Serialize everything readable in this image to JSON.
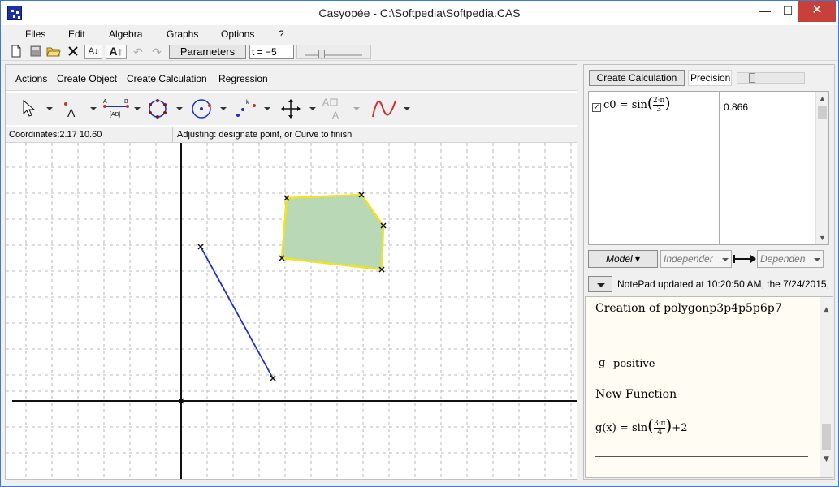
{
  "window": {
    "title": "Casyopée - C:\\Softpedia\\Softpedia.CAS",
    "minimize": "—",
    "maximize": "☐",
    "close": "✕"
  },
  "menu": [
    "Files",
    "Edit",
    "Algebra",
    "Graphs",
    "Options",
    "?"
  ],
  "toolbar": {
    "parameters_label": "Parameters",
    "t_value": "t = −5"
  },
  "left": {
    "menu": [
      "Actions",
      "Create Object",
      "Create Calculation",
      "Regression"
    ],
    "coordinates": "Coordinates:2.17 10.60",
    "adjust_status": "Adjusting: designate point, or Curve to finish",
    "tool_text": {
      "point_label": "A",
      "segment_a": "A",
      "segment_b": "B",
      "segment_ab": "[AB]",
      "slope_k": "k",
      "text_a": "A",
      "text_ax": "A"
    }
  },
  "right": {
    "create_calc_label": "Create Calculation",
    "precision_label": "Precision",
    "calc_row": {
      "name": "c0",
      "formula_prefix": "c0 = sin",
      "num": "2·π",
      "den": "3",
      "value": "0.866",
      "checked": "✓"
    },
    "model_label": "Model",
    "independent_label": "Independer",
    "dependent_label": "Dependen",
    "notepad_status": "NotePad updated at 10:20:50 AM, the 7/24/2015,",
    "notepad": {
      "line1": "Creation of polygonp3p4p5p6p7",
      "g_name": "g",
      "g_status": "positive",
      "new_function": "New Function",
      "gx_prefix": "g(x) = sin",
      "gx_num": "3·π",
      "gx_den": "4",
      "gx_suffix": "+2"
    }
  },
  "colors": {
    "accent_border": "#3b7bd1",
    "close_button": "#c7403a",
    "polygon_fill": "#b9d8b6",
    "polygon_stroke": "#f2e31d",
    "segment": "#1a2fd0",
    "notepad_bg": "#fffcf3"
  }
}
